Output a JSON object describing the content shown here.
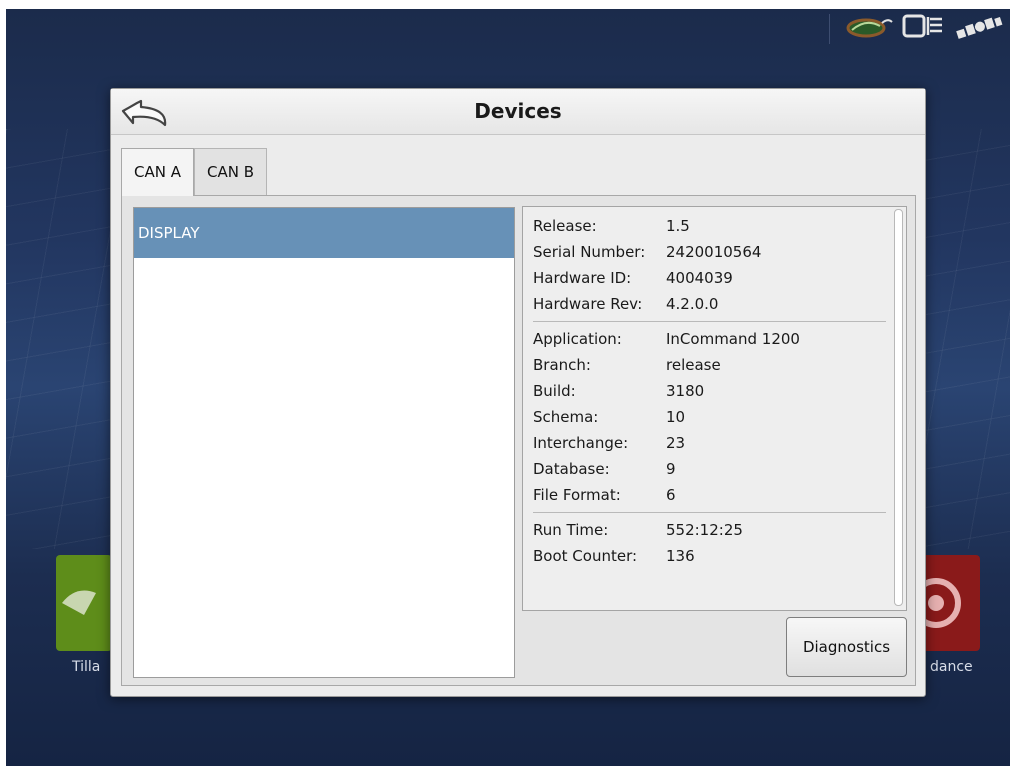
{
  "background": {
    "apps": [
      {
        "label": "Tilla",
        "color": "#5e8d1a"
      },
      {
        "label": "dance",
        "color": "#8a1a1a"
      }
    ]
  },
  "status_bar": {
    "icons": [
      "seed-leaf-icon",
      "square-output-icon",
      "satellite-icon"
    ]
  },
  "dialog": {
    "title": "Devices",
    "back_icon": "back-arrow-icon",
    "tabs": [
      {
        "label": "CAN A",
        "active": true
      },
      {
        "label": "CAN B",
        "active": false
      }
    ],
    "devices": [
      {
        "label": "DISPLAY",
        "selected": true
      }
    ],
    "info": {
      "release_label": "Release:",
      "release_value": "1.5",
      "serial_label": "Serial Number:",
      "serial_value": "2420010564",
      "hardware_id_label": "Hardware ID:",
      "hardware_id_value": "4004039",
      "hardware_rev_label": "Hardware Rev:",
      "hardware_rev_value": "4.2.0.0",
      "application_label": "Application:",
      "application_value": "InCommand 1200",
      "branch_label": "Branch:",
      "branch_value": "release",
      "build_label": "Build:",
      "build_value": "3180",
      "schema_label": "Schema:",
      "schema_value": "10",
      "interchange_label": "Interchange:",
      "interchange_value": "23",
      "database_label": "Database:",
      "database_value": "9",
      "file_format_label": "File Format:",
      "file_format_value": "6",
      "run_time_label": "Run Time:",
      "run_time_value": "552:12:25",
      "boot_counter_label": "Boot Counter:",
      "boot_counter_value": "136"
    },
    "diagnostics_label": "Diagnostics"
  },
  "colors": {
    "selected_row": "#6791b7",
    "screen_bg": "#223660"
  }
}
